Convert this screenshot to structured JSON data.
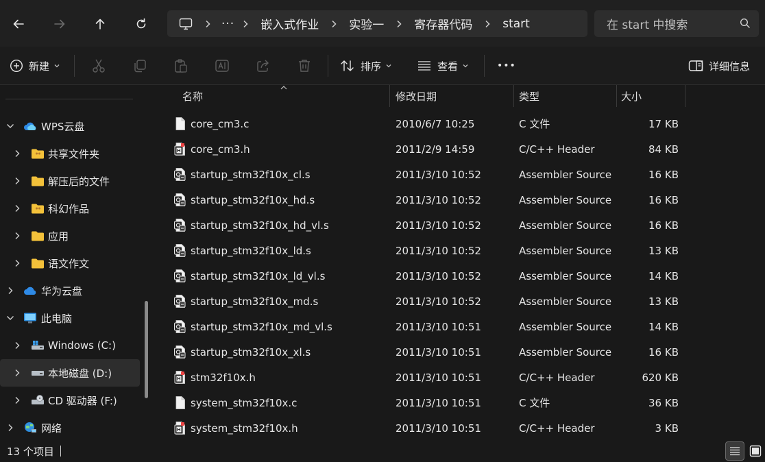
{
  "nav": {
    "back_icon": "arrow-left-icon",
    "forward_icon": "arrow-right-icon",
    "up_icon": "arrow-up-icon",
    "refresh_icon": "refresh-icon"
  },
  "address": {
    "root_icon": "monitor-icon",
    "overflow": "···",
    "segments": [
      "嵌入式作业",
      "实验一",
      "寄存器代码",
      "start"
    ]
  },
  "search": {
    "placeholder": "在 start 中搜索",
    "icon": "search-icon"
  },
  "toolbar": {
    "new_label": "新建",
    "sort_label": "排序",
    "view_label": "查看",
    "more_label": "•••",
    "details_label": "详细信息",
    "icons": [
      "plus-circle-icon",
      "cut-icon",
      "copy-icon",
      "paste-icon",
      "rename-icon",
      "share-icon",
      "delete-icon"
    ]
  },
  "sidebar": {
    "items": [
      {
        "label": "WPS云盘",
        "icon": "cloud-icon",
        "level": 0,
        "expanded": true
      },
      {
        "label": "共享文件夹",
        "icon": "folder-icon",
        "level": 1,
        "expanded": false
      },
      {
        "label": "解压后的文件",
        "icon": "folder-icon",
        "level": 1,
        "expanded": false
      },
      {
        "label": "科幻作品",
        "icon": "folder-icon",
        "level": 1,
        "expanded": false
      },
      {
        "label": "应用",
        "icon": "folder-icon",
        "level": 1,
        "expanded": false
      },
      {
        "label": "语文作文",
        "icon": "folder-icon",
        "level": 1,
        "expanded": false
      },
      {
        "label": "华为云盘",
        "icon": "cloud-icon",
        "level": 0,
        "expanded": false
      },
      {
        "label": "此电脑",
        "icon": "monitor-icon",
        "level": 0,
        "expanded": true
      },
      {
        "label": "Windows (C:)",
        "icon": "drive-icon",
        "level": 1,
        "expanded": false
      },
      {
        "label": "本地磁盘 (D:)",
        "icon": "drive-icon",
        "level": 1,
        "expanded": false,
        "selected": true
      },
      {
        "label": "CD 驱动器 (F:)",
        "icon": "cd-drive-icon",
        "level": 1,
        "expanded": false
      },
      {
        "label": "网络",
        "icon": "network-icon",
        "level": 0,
        "expanded": false
      }
    ]
  },
  "columns": {
    "name": "名称",
    "modified": "修改日期",
    "type": "类型",
    "size": "大小"
  },
  "files": [
    {
      "name": "core_cm3.c",
      "modified": "2010/6/7 10:25",
      "type": "C 文件",
      "size": "17 KB",
      "icon": "file-icon"
    },
    {
      "name": "core_cm3.h",
      "modified": "2011/2/9 14:59",
      "type": "C/C++ Header",
      "size": "84 KB",
      "icon": "header-file-icon"
    },
    {
      "name": "startup_stm32f10x_cl.s",
      "modified": "2011/3/10 10:52",
      "type": "Assembler Source",
      "size": "16 KB",
      "icon": "assembler-file-icon"
    },
    {
      "name": "startup_stm32f10x_hd.s",
      "modified": "2011/3/10 10:52",
      "type": "Assembler Source",
      "size": "16 KB",
      "icon": "assembler-file-icon"
    },
    {
      "name": "startup_stm32f10x_hd_vl.s",
      "modified": "2011/3/10 10:52",
      "type": "Assembler Source",
      "size": "16 KB",
      "icon": "assembler-file-icon"
    },
    {
      "name": "startup_stm32f10x_ld.s",
      "modified": "2011/3/10 10:52",
      "type": "Assembler Source",
      "size": "13 KB",
      "icon": "assembler-file-icon"
    },
    {
      "name": "startup_stm32f10x_ld_vl.s",
      "modified": "2011/3/10 10:52",
      "type": "Assembler Source",
      "size": "14 KB",
      "icon": "assembler-file-icon"
    },
    {
      "name": "startup_stm32f10x_md.s",
      "modified": "2011/3/10 10:52",
      "type": "Assembler Source",
      "size": "13 KB",
      "icon": "assembler-file-icon"
    },
    {
      "name": "startup_stm32f10x_md_vl.s",
      "modified": "2011/3/10 10:51",
      "type": "Assembler Source",
      "size": "14 KB",
      "icon": "assembler-file-icon"
    },
    {
      "name": "startup_stm32f10x_xl.s",
      "modified": "2011/3/10 10:51",
      "type": "Assembler Source",
      "size": "16 KB",
      "icon": "assembler-file-icon"
    },
    {
      "name": "stm32f10x.h",
      "modified": "2011/3/10 10:51",
      "type": "C/C++ Header",
      "size": "620 KB",
      "icon": "header-file-icon"
    },
    {
      "name": "system_stm32f10x.c",
      "modified": "2011/3/10 10:51",
      "type": "C 文件",
      "size": "36 KB",
      "icon": "file-icon"
    },
    {
      "name": "system_stm32f10x.h",
      "modified": "2011/3/10 10:51",
      "type": "C/C++ Header",
      "size": "3 KB",
      "icon": "header-file-icon"
    }
  ],
  "status": {
    "count_text": "13 个项目",
    "details_view_icon": "details-view-icon",
    "tiles_view_icon": "tiles-view-icon"
  },
  "colors": {
    "background": "#191919",
    "panel": "#202020",
    "selected": "#2d2d2d",
    "folder": "#f3c13a",
    "cloud_blue": "#2e8ae6"
  }
}
